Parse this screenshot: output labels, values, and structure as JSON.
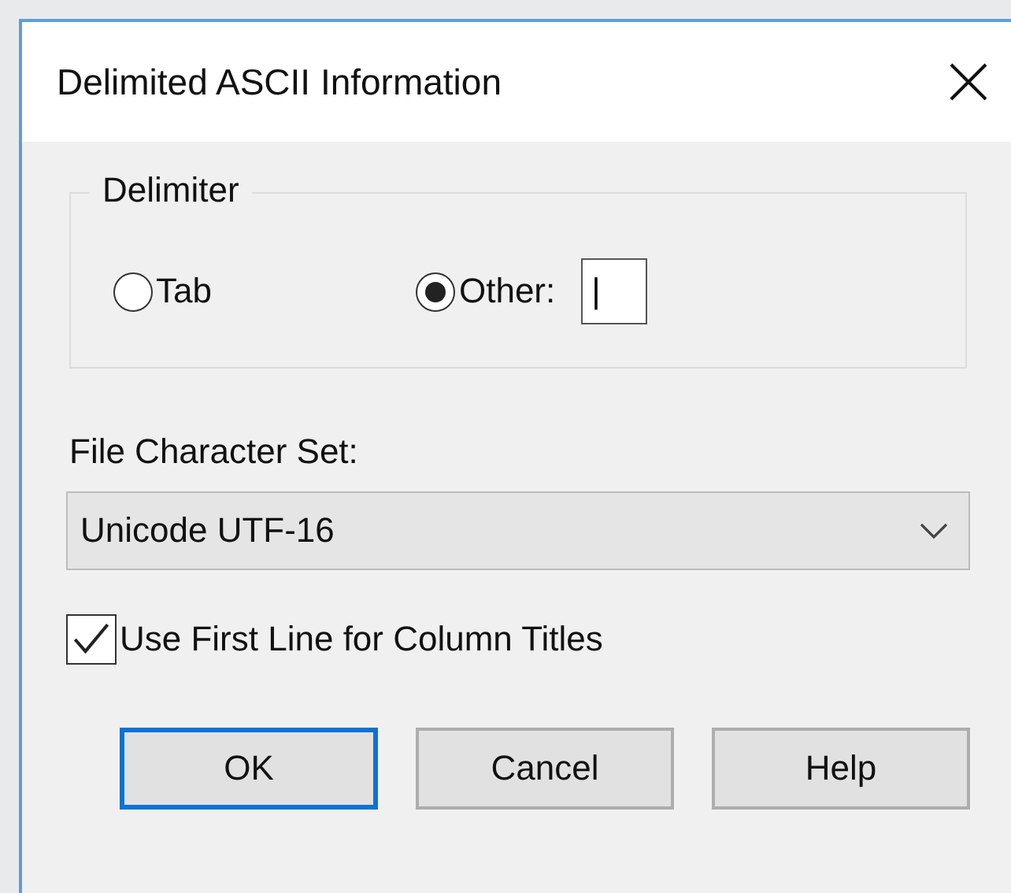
{
  "window": {
    "title": "Delimited ASCII Information"
  },
  "delimiter": {
    "legend": "Delimiter",
    "options": [
      {
        "label": "Tab",
        "selected": false
      },
      {
        "label": "Other:",
        "selected": true
      }
    ],
    "other_value": "|"
  },
  "character_set": {
    "label": "File Character Set:",
    "value": "Unicode UTF-16"
  },
  "use_first_line": {
    "label": "Use First Line for Column Titles",
    "checked": true
  },
  "buttons": [
    {
      "label": "OK",
      "default": true
    },
    {
      "label": "Cancel",
      "default": false
    },
    {
      "label": "Help",
      "default": false
    }
  ]
}
